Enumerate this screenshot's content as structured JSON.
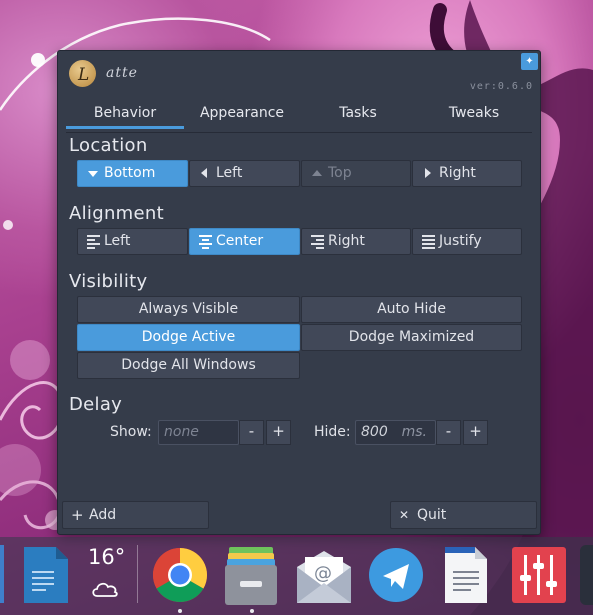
{
  "window": {
    "logo_text": "atte",
    "version": "ver:0.6.0",
    "pin_icon": "pin-icon"
  },
  "tabs": [
    {
      "label": "Behavior",
      "active": true
    },
    {
      "label": "Appearance",
      "active": false
    },
    {
      "label": "Tasks",
      "active": false
    },
    {
      "label": "Tweaks",
      "active": false
    }
  ],
  "location": {
    "title": "Location",
    "options": [
      {
        "label": "Bottom",
        "icon": "arrow-down-icon",
        "selected": true,
        "enabled": true
      },
      {
        "label": "Left",
        "icon": "arrow-left-icon",
        "selected": false,
        "enabled": true
      },
      {
        "label": "Top",
        "icon": "arrow-up-icon",
        "selected": false,
        "enabled": false
      },
      {
        "label": "Right",
        "icon": "arrow-right-icon",
        "selected": false,
        "enabled": true
      }
    ]
  },
  "alignment": {
    "title": "Alignment",
    "options": [
      {
        "label": "Left",
        "icon": "align-left-icon",
        "selected": false
      },
      {
        "label": "Center",
        "icon": "align-center-icon",
        "selected": true
      },
      {
        "label": "Right",
        "icon": "align-right-icon",
        "selected": false
      },
      {
        "label": "Justify",
        "icon": "align-justify-icon",
        "selected": false
      }
    ]
  },
  "visibility": {
    "title": "Visibility",
    "options": [
      {
        "label": "Always Visible",
        "selected": false
      },
      {
        "label": "Auto Hide",
        "selected": false
      },
      {
        "label": "Dodge Active",
        "selected": true
      },
      {
        "label": "Dodge Maximized",
        "selected": false
      },
      {
        "label": "Dodge All Windows",
        "selected": false
      }
    ]
  },
  "delay": {
    "title": "Delay",
    "show_label": "Show:",
    "show_placeholder": "none",
    "hide_label": "Hide:",
    "hide_value": "800",
    "unit": "ms.",
    "minus": "-",
    "plus": "+"
  },
  "footer": {
    "add_label": "Add",
    "add_icon": "+",
    "quit_label": "Quit",
    "quit_icon": "✕"
  },
  "dock": {
    "weather_temp": "16°",
    "items": [
      "file-manager-icon",
      "weather-cloud-icon",
      "chrome-icon",
      "files-icon",
      "mail-icon",
      "telegram-icon",
      "document-icon",
      "mixer-icon"
    ],
    "colors": {
      "accent": "#4a9bdc",
      "window_bg": "#353c4a",
      "button_bg": "#414858"
    }
  }
}
